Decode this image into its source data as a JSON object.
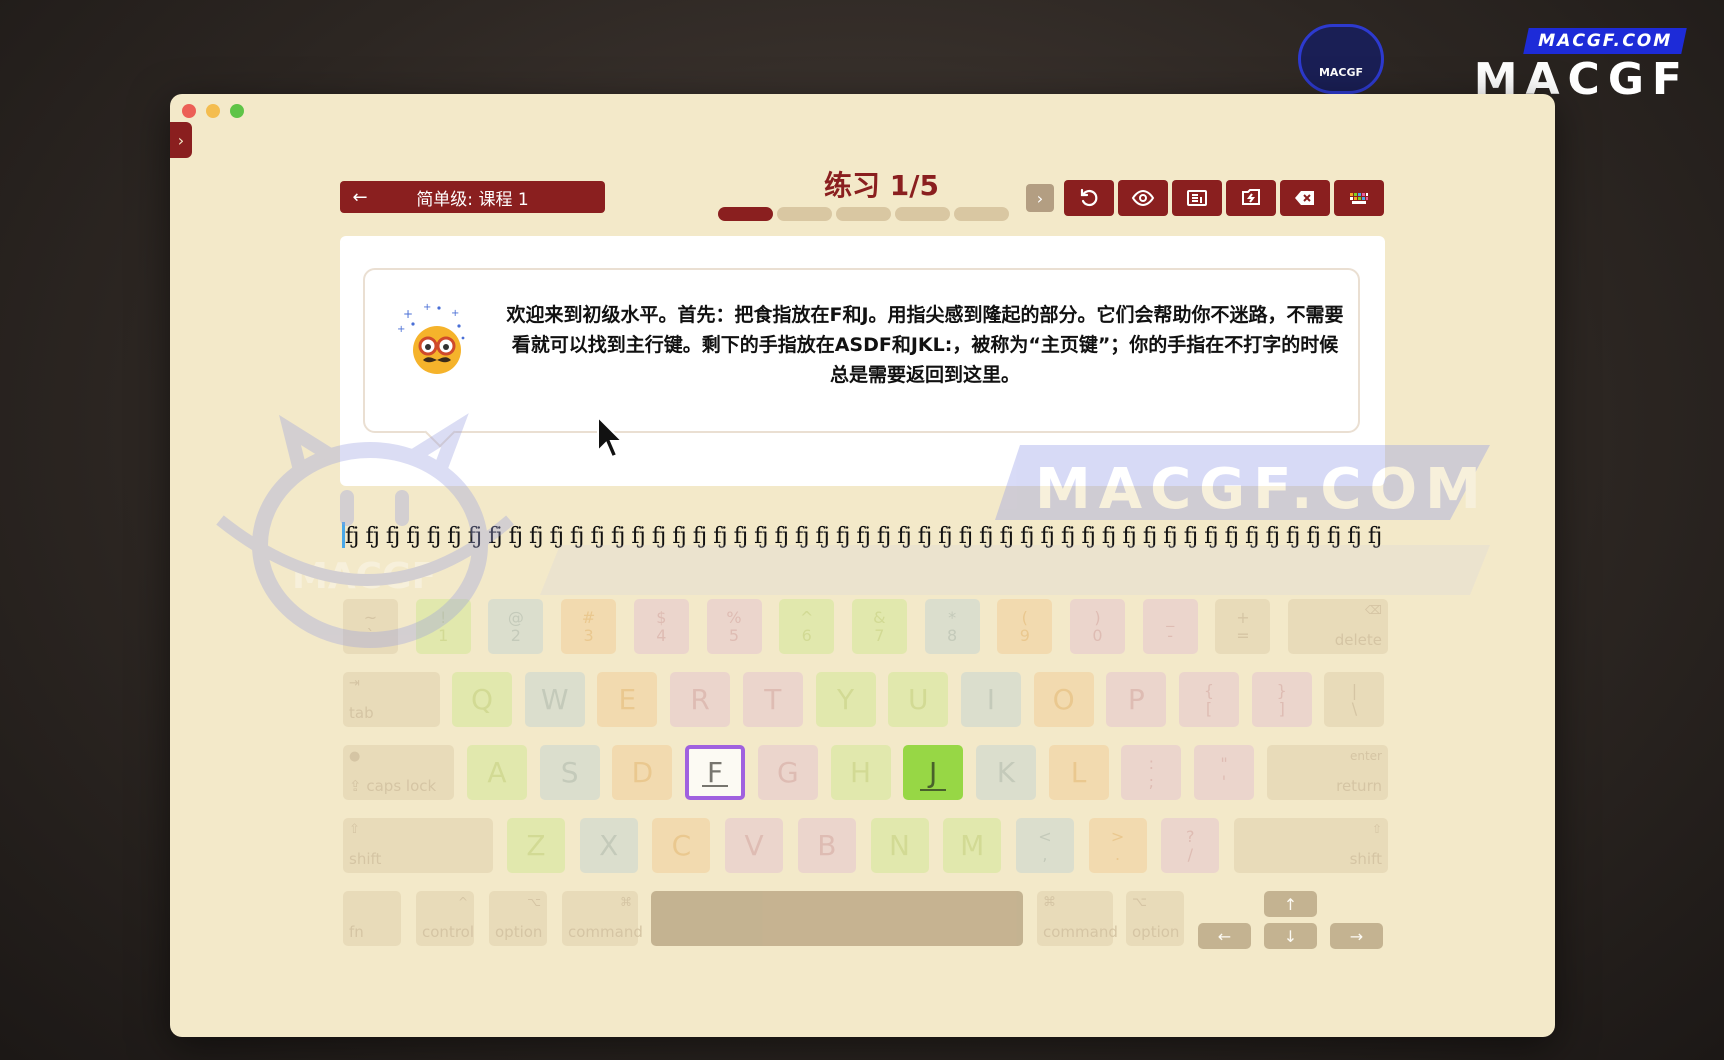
{
  "watermark": {
    "url": "MACGF.COM",
    "brand": "MACGF",
    "cat_text": "MACGF",
    "big_text": "MACGF.COM",
    "big_cat_text": "MACGF"
  },
  "header": {
    "back_arrow": "←",
    "lesson_label": "简单级: 课程 1",
    "title": "练习 1/5",
    "progress": {
      "current": 1,
      "total": 5
    },
    "next_symbol": "›"
  },
  "tools": [
    {
      "name": "restart-icon"
    },
    {
      "name": "eye-icon"
    },
    {
      "name": "layout-icon"
    },
    {
      "name": "sync-icon"
    },
    {
      "name": "clear-icon"
    },
    {
      "name": "keyboard-icon"
    }
  ],
  "instruction": "欢迎来到初级水平。首先：把食指放在F和J。用指尖感到隆起的部分。它们会帮助你不迷路，不需要看就可以找到主行键。剩下的手指放在ASDF和JKL:，被称为“主页键”；你的手指在不打字的时候总是需要返回到这里。",
  "practice_text": "fj fj fj fj fj fj fj fj fj fj fj fj fj fj fj fj fj fj fj fj fj fj fj fj fj fj fj fj fj fj fj fj fj fj fj fj fj fj fj fj fj fj fj fj fj fj fj fj fj fj fj fj fj fj fj fj fj fj fj fj fj fj fj fj fj fj fj fj fj fj fj fj fj fj fj fj fj fj fj fj fj fj fj fj",
  "keyboard": {
    "row1": [
      {
        "top": "~",
        "bot": "`",
        "c": "gray"
      },
      {
        "top": "!",
        "bot": "1",
        "c": "green"
      },
      {
        "top": "@",
        "bot": "2",
        "c": "blue"
      },
      {
        "top": "#",
        "bot": "3",
        "c": "orange"
      },
      {
        "top": "$",
        "bot": "4",
        "c": "pink"
      },
      {
        "top": "%",
        "bot": "5",
        "c": "pink"
      },
      {
        "top": "^",
        "bot": "6",
        "c": "green"
      },
      {
        "top": "&",
        "bot": "7",
        "c": "green"
      },
      {
        "top": "*",
        "bot": "8",
        "c": "blue"
      },
      {
        "top": "(",
        "bot": "9",
        "c": "orange"
      },
      {
        "top": ")",
        "bot": "0",
        "c": "pink"
      },
      {
        "top": "_",
        "bot": "-",
        "c": "pink"
      },
      {
        "top": "+",
        "bot": "=",
        "c": "gray"
      }
    ],
    "delete_label": "delete",
    "delete_symbol": "⌫",
    "tab_label": "tab",
    "tab_symbol": "⇥",
    "row2": [
      {
        "k": "Q",
        "c": "green"
      },
      {
        "k": "W",
        "c": "blue"
      },
      {
        "k": "E",
        "c": "orange"
      },
      {
        "k": "R",
        "c": "pink"
      },
      {
        "k": "T",
        "c": "pink"
      },
      {
        "k": "Y",
        "c": "green"
      },
      {
        "k": "U",
        "c": "green"
      },
      {
        "k": "I",
        "c": "blue"
      },
      {
        "k": "O",
        "c": "orange"
      },
      {
        "k": "P",
        "c": "pink"
      }
    ],
    "row2_sym": [
      {
        "top": "{",
        "bot": "[",
        "c": "pink"
      },
      {
        "top": "}",
        "bot": "]",
        "c": "pink"
      },
      {
        "top": "|",
        "bot": "\\",
        "c": "gray"
      }
    ],
    "caps_label": "caps lock",
    "caps_symbol": "⇪",
    "caps_dot": "●",
    "row3": [
      {
        "k": "A",
        "c": "green"
      },
      {
        "k": "S",
        "c": "blue"
      },
      {
        "k": "D",
        "c": "orange"
      },
      {
        "k": "F",
        "c": "f"
      },
      {
        "k": "G",
        "c": "pink"
      },
      {
        "k": "H",
        "c": "green"
      },
      {
        "k": "J",
        "c": "j"
      },
      {
        "k": "K",
        "c": "blue"
      },
      {
        "k": "L",
        "c": "orange"
      }
    ],
    "row3_sym": [
      {
        "top": ":",
        "bot": ";",
        "c": "pink"
      },
      {
        "top": "\"",
        "bot": "'",
        "c": "pink"
      }
    ],
    "enter_label": "enter",
    "return_label": "return",
    "shift_label": "shift",
    "shift_symbol": "⇧",
    "row4": [
      {
        "k": "Z",
        "c": "green"
      },
      {
        "k": "X",
        "c": "blue"
      },
      {
        "k": "C",
        "c": "orange"
      },
      {
        "k": "V",
        "c": "pink"
      },
      {
        "k": "B",
        "c": "pink"
      },
      {
        "k": "N",
        "c": "green"
      },
      {
        "k": "M",
        "c": "green"
      }
    ],
    "row4_sym": [
      {
        "top": "<",
        "bot": ",",
        "c": "blue"
      },
      {
        "top": ">",
        "bot": ".",
        "c": "orange"
      },
      {
        "top": "?",
        "bot": "/",
        "c": "pink"
      }
    ],
    "fn_label": "fn",
    "control_label": "control",
    "control_symbol": "^",
    "option_label": "option",
    "option_symbol": "⌥",
    "command_label": "command",
    "command_symbol": "⌘",
    "arrows": {
      "up": "↑",
      "down": "↓",
      "left": "←",
      "right": "→"
    }
  }
}
